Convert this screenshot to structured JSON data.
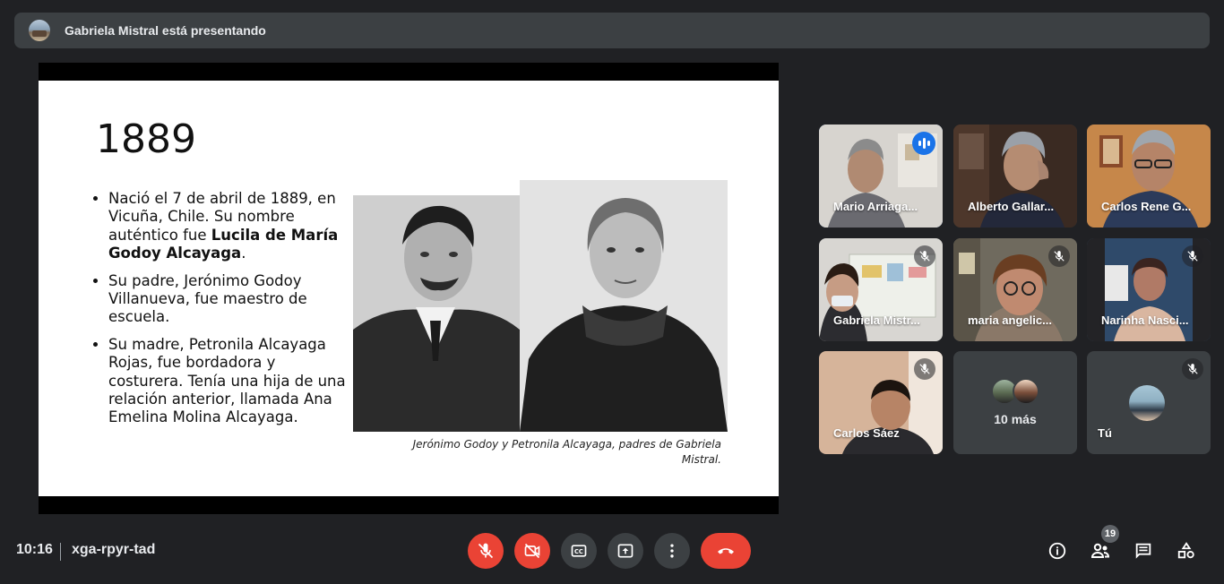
{
  "banner": {
    "text": "Gabriela Mistral está presentando"
  },
  "slide": {
    "year": "1889",
    "bullets": {
      "b1_a": "Nació el 7 de abril de 1889, en Vicuña, Chile. Su nombre auténtico fue ",
      "b1_bold": "Lucila de María Godoy Alcayaga",
      "b1_c": ".",
      "b2": "Su padre, Jerónimo Godoy Villanueva, fue maestro de escuela.",
      "b3": "Su madre, Petronila Alcayaga Rojas, fue bordadora y costurera. Tenía una hija de una relación anterior, llamada Ana Emelina Molina Alcayaga."
    },
    "caption": "Jerónimo Godoy y Petronila Alcayaga, padres de Gabriela Mistral."
  },
  "participants": [
    {
      "name": "Mario Arriaga...",
      "state": "speaking"
    },
    {
      "name": "Alberto Gallar...",
      "state": "none"
    },
    {
      "name": "Carlos Rene G...",
      "state": "none"
    },
    {
      "name": "Gabriela Mistr...",
      "state": "muted"
    },
    {
      "name": "maria angelic...",
      "state": "muted"
    },
    {
      "name": "Narinha Nasci...",
      "state": "muted"
    },
    {
      "name": "Carlos Sáez",
      "state": "muted"
    }
  ],
  "more_tile": {
    "label": "10 más"
  },
  "self_tile": {
    "label": "Tú",
    "state": "muted"
  },
  "bottom": {
    "time": "10:16",
    "meeting_code": "xga-rpyr-tad",
    "participant_count": "19"
  },
  "colors": {
    "background": "#202124",
    "surface": "#3c4043",
    "danger": "#ea4335",
    "speaking": "#1a73e8",
    "active_border": "#8ab4f8"
  }
}
